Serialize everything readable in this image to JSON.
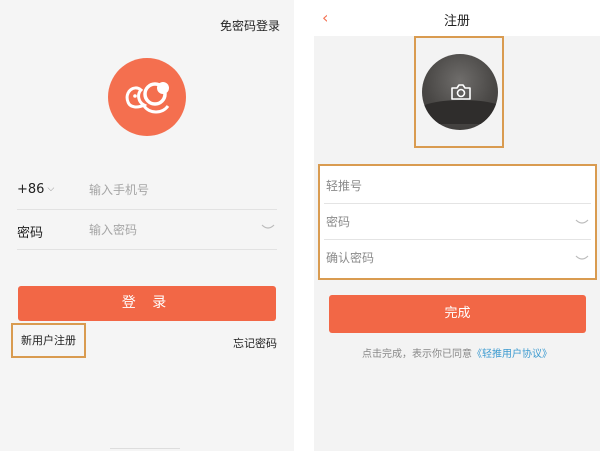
{
  "login": {
    "top_link": "免密码登录",
    "country_code": "+86",
    "phone_placeholder": "输入手机号",
    "password_label": "密码",
    "password_placeholder": "输入密码",
    "login_button": "登 录",
    "register_link": "新用户注册",
    "forgot_link": "忘记密码"
  },
  "register": {
    "title": "注册",
    "back": "‹",
    "fields": [
      {
        "placeholder": "轻推号"
      },
      {
        "placeholder": "密码"
      },
      {
        "placeholder": "确认密码"
      }
    ],
    "done_button": "完成",
    "agreement_text": "点击完成，表示你已同意",
    "agreement_link": "《轻推用户协议》"
  },
  "colors": {
    "accent": "#f26746",
    "highlight_border": "#d99b50",
    "link": "#3d9bd0"
  },
  "icons": [
    "logo-icon",
    "chevron-down-icon",
    "eye-icon",
    "back-icon",
    "camera-icon"
  ]
}
